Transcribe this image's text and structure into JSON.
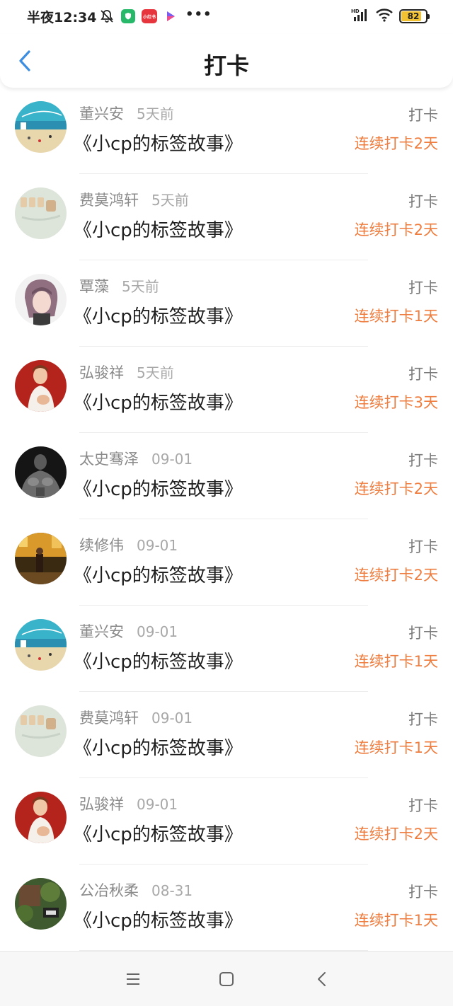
{
  "status_bar": {
    "time": "半夜12:34",
    "app_badge": "小红书",
    "battery": "82",
    "battery_level": 0.82,
    "network": "HD"
  },
  "header": {
    "title": "打卡",
    "accent_color": "#3d8de0"
  },
  "colors": {
    "streak": "#ee7d3f",
    "name": "#8a8a8a"
  },
  "checkins": [
    {
      "name": "董兴安",
      "time": "5天前",
      "title": "《小cp的标签故事》",
      "action": "打卡",
      "streak": "连续打卡2天",
      "avatar": "beach"
    },
    {
      "name": "费莫鸿轩",
      "time": "5天前",
      "title": "《小cp的标签故事》",
      "action": "打卡",
      "streak": "连续打卡2天",
      "avatar": "stamps"
    },
    {
      "name": "覃藻",
      "time": "5天前",
      "title": "《小cp的标签故事》",
      "action": "打卡",
      "streak": "连续打卡1天",
      "avatar": "girl"
    },
    {
      "name": "弘骏祥",
      "time": "5天前",
      "title": "《小cp的标签故事》",
      "action": "打卡",
      "streak": "连续打卡3天",
      "avatar": "red-woman"
    },
    {
      "name": "太史骞泽",
      "time": "09-01",
      "title": "《小cp的标签故事》",
      "action": "打卡",
      "streak": "连续打卡2天",
      "avatar": "muscle"
    },
    {
      "name": "续修伟",
      "time": "09-01",
      "title": "《小cp的标签故事》",
      "action": "打卡",
      "streak": "连续打卡2天",
      "avatar": "street"
    },
    {
      "name": "董兴安",
      "time": "09-01",
      "title": "《小cp的标签故事》",
      "action": "打卡",
      "streak": "连续打卡1天",
      "avatar": "beach"
    },
    {
      "name": "费莫鸿轩",
      "time": "09-01",
      "title": "《小cp的标签故事》",
      "action": "打卡",
      "streak": "连续打卡1天",
      "avatar": "stamps"
    },
    {
      "name": "弘骏祥",
      "time": "09-01",
      "title": "《小cp的标签故事》",
      "action": "打卡",
      "streak": "连续打卡2天",
      "avatar": "red-woman"
    },
    {
      "name": "公冶秋柔",
      "time": "08-31",
      "title": "《小cp的标签故事》",
      "action": "打卡",
      "streak": "连续打卡1天",
      "avatar": "garden"
    }
  ],
  "nav": {
    "menu_icon": "menu-icon",
    "home_icon": "home-icon",
    "back_icon": "back-icon"
  }
}
